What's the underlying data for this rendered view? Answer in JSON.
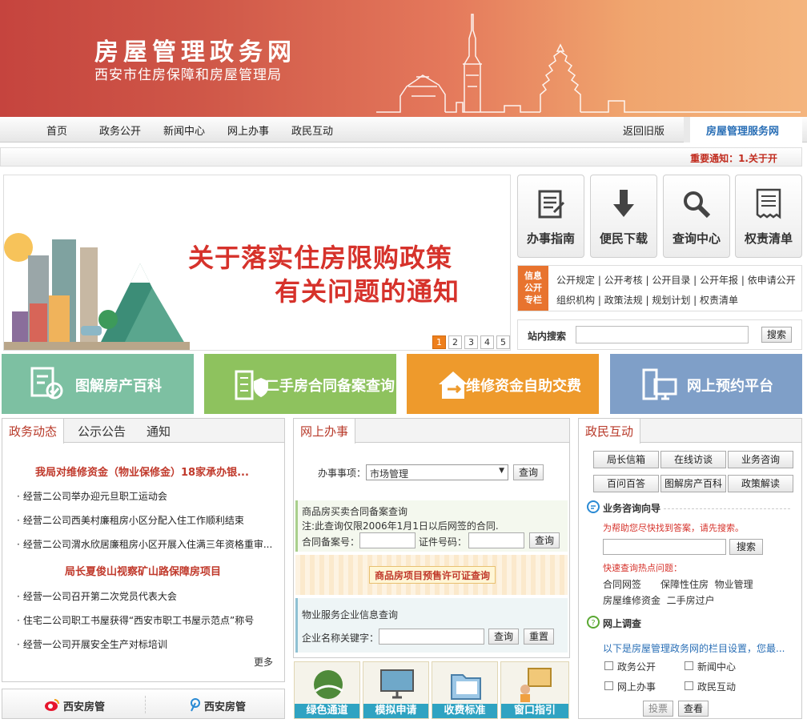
{
  "header": {
    "title": "房屋管理政务网",
    "subtitle": "西安市住房保障和房屋管理局"
  },
  "nav": {
    "items": [
      "首页",
      "政务公开",
      "新闻中心",
      "网上办事",
      "政民互动"
    ],
    "old_version": "返回旧版",
    "service_site": "房屋管理服务网"
  },
  "notice": "重要通知：1.关于开",
  "carousel": {
    "line1": "关于落实住房限购政策",
    "line2": "有关问题的通知",
    "pages": [
      "1",
      "2",
      "3",
      "4",
      "5"
    ]
  },
  "quick_buttons": [
    "办事指南",
    "便民下载",
    "查询中心",
    "权责清单"
  ],
  "info_column": {
    "tag": [
      "信息",
      "公开",
      "专栏"
    ],
    "row1": "公开规定 | 公开考核 | 公开目录 | 公开年报 | 依申请公开",
    "row2": "组织机构 | 政策法规 | 规划计划 | 权责清单"
  },
  "site_search": {
    "label": "站内搜索",
    "button": "搜索"
  },
  "tiles": [
    "图解房产百科",
    "二手房合同备案查询",
    "维修资金自助交费",
    "网上预约平台"
  ],
  "colors": {
    "tile1": "#7dc0a2",
    "tile2": "#8ec25e",
    "tile3": "#ee9a2c",
    "tile4": "#7f9fc8",
    "accent": "#c0392b"
  },
  "news": {
    "tabs": [
      "政务动态",
      "公示公告",
      "通知"
    ],
    "headline1": "我局对维修资金（物业保修金）18家承办银...",
    "items1": [
      "经营二公司举办迎元旦职工运动会",
      "经营二公司西美村廉租房小区分配入住工作顺利结束",
      "经营二公司渭水欣居廉租房小区开展入住满三年资格重审..."
    ],
    "headline2": "局长夏俊山视察矿山路保障房项目",
    "items2": [
      "经营一公司召开第二次党员代表大会",
      "住宅二公司职工书屋获得“西安市职工书屋示范点”称号",
      "经营一公司开展安全生产对标培训"
    ],
    "more": "更多"
  },
  "weibo": {
    "sina": "西安房管",
    "tencent": "西安房管"
  },
  "office": {
    "tab": "网上办事",
    "matter_label": "办事事项：",
    "matter_value": "市场管理",
    "query": "查询",
    "contract_title": "商品房买卖合同备案查询",
    "contract_note": "注:此查询仅限2006年1月1日以后网签的合同.",
    "contract_no_label": "合同备案号：",
    "cert_no_label": "证件号码：",
    "presale": "商品房项目预售许可证查询",
    "property_title": "物业服务企业信息查询",
    "company_label": "企业名称关键字：",
    "reset": "重置",
    "thumbs": [
      "绿色通道",
      "模拟申请",
      "收费标准",
      "窗口指引"
    ]
  },
  "interaction": {
    "tab": "政民互动",
    "buttons": [
      "局长信箱",
      "在线访谈",
      "业务咨询",
      "百问百答",
      "图解房产百科",
      "政策解读"
    ],
    "consult_title": "业务咨询向导",
    "consult_hint": "为帮助您尽快找到答案，请先搜索。",
    "search": "搜索",
    "hot_title": "快速查询热点问题：",
    "hot1": "合同网签　　保障性住房  物业管理",
    "hot2": "房屋维修资金  二手房过户",
    "survey_title": "网上调查",
    "survey_desc": "以下是房屋管理政务网的栏目设置，您最...",
    "options": [
      "政务公开",
      "新闻中心",
      "网上办事",
      "政民互动"
    ],
    "vote": "投票",
    "view": "查看"
  }
}
